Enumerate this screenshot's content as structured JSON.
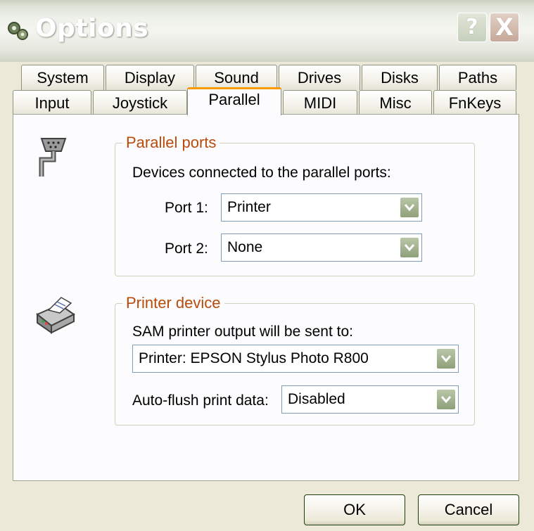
{
  "window": {
    "title": "Options"
  },
  "titlebar": {
    "help_label": "?",
    "close_label": "X"
  },
  "tabs": {
    "row_back": [
      "System",
      "Display",
      "Sound",
      "Drives",
      "Disks",
      "Paths"
    ],
    "row_front": [
      "Input",
      "Joystick",
      "Parallel",
      "MIDI",
      "Misc",
      "FnKeys"
    ],
    "active": "Parallel"
  },
  "parallel_ports": {
    "title": "Parallel ports",
    "description": "Devices connected to the parallel ports:",
    "port1_label": "Port 1:",
    "port1_value": "Printer",
    "port2_label": "Port 2:",
    "port2_value": "None"
  },
  "printer_device": {
    "title": "Printer device",
    "description": "SAM printer output will be sent to:",
    "printer_value": "Printer: EPSON Stylus Photo R800",
    "autoflush_label": "Auto-flush print data:",
    "autoflush_value": "Disabled"
  },
  "buttons": {
    "ok": "OK",
    "cancel": "Cancel"
  },
  "icons": {
    "app": "gear-icon",
    "parallel_port": "parallel-port-icon",
    "printer": "printer-icon"
  }
}
